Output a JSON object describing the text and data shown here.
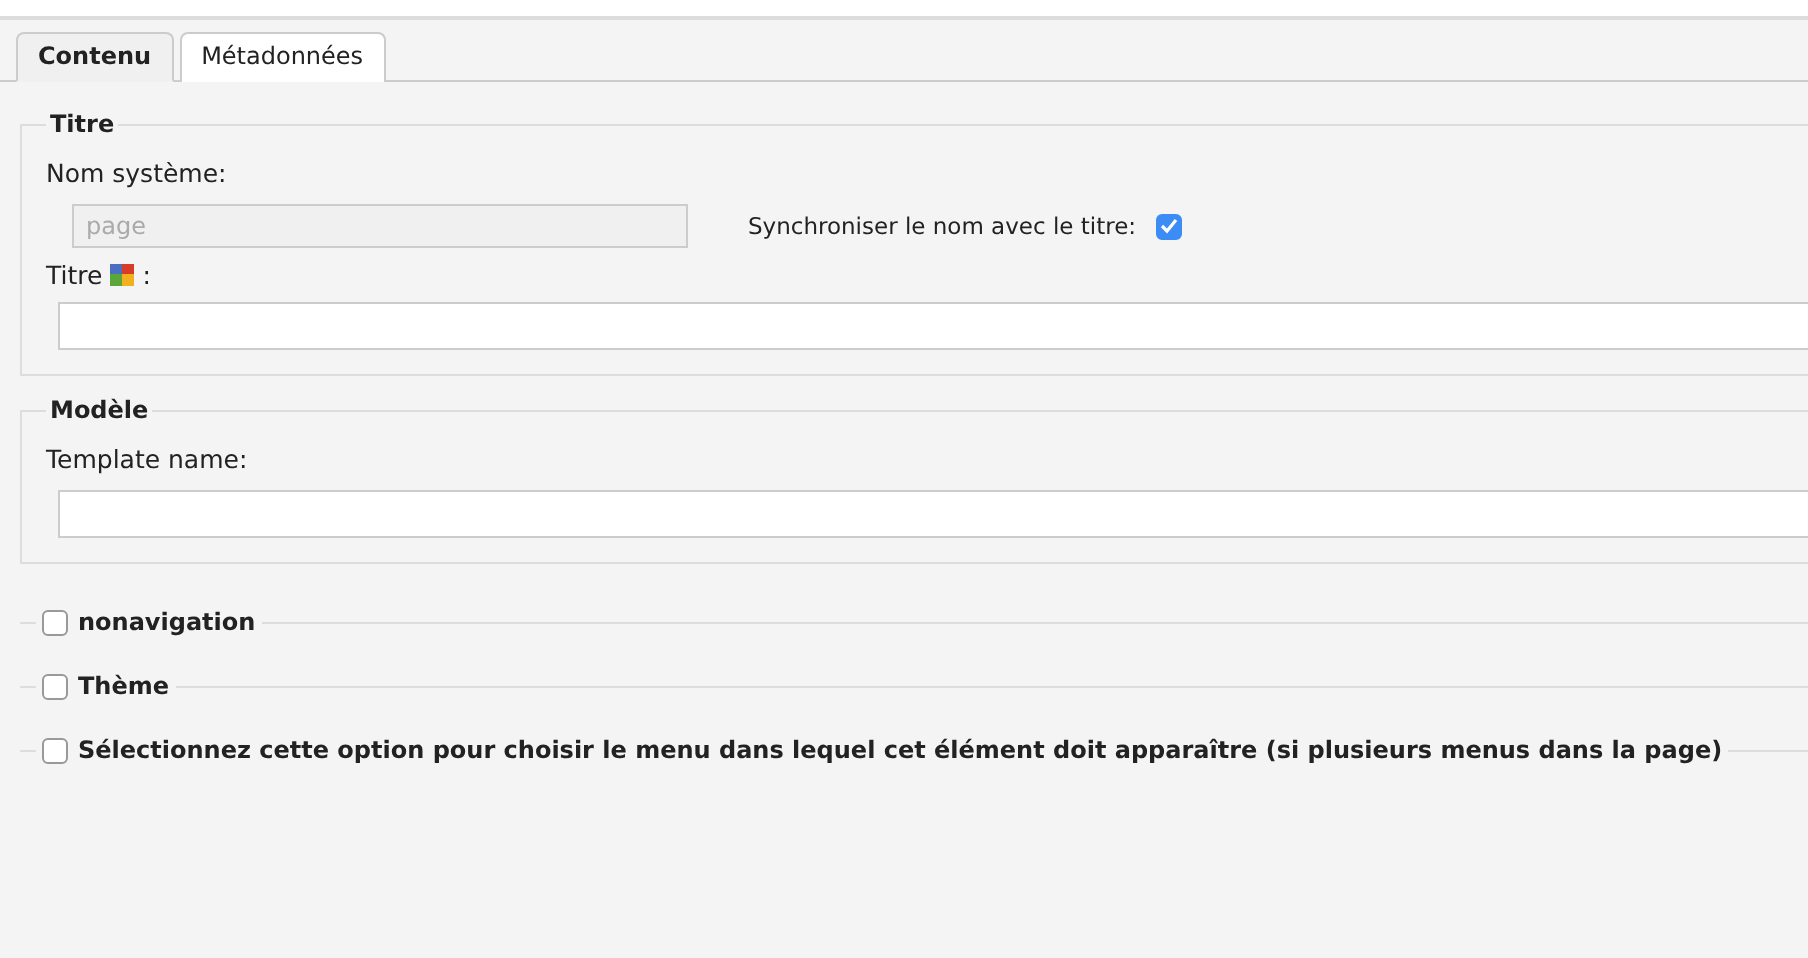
{
  "tabs": [
    {
      "label": "Contenu",
      "selected": true
    },
    {
      "label": "Métadonnées",
      "selected": false
    }
  ],
  "sections": [
    {
      "legend": "Titre",
      "kind": "titre",
      "system_name_label": "Nom système:",
      "system_name_value": "page",
      "sync_label": "Synchroniser le nom avec le titre:",
      "sync_checked": true,
      "title_label": "Titre",
      "title_suffix": ":"
    },
    {
      "legend": "Modèle",
      "kind": "modele",
      "field_label": "Template name:"
    }
  ],
  "options": [
    {
      "label": "nonavigation",
      "checked": false
    },
    {
      "label": "Thème",
      "checked": false
    },
    {
      "label": "Sélectionnez cette option pour choisir le menu dans lequel cet élément doit apparaître (si plusieurs menus dans la page)",
      "checked": false
    }
  ]
}
